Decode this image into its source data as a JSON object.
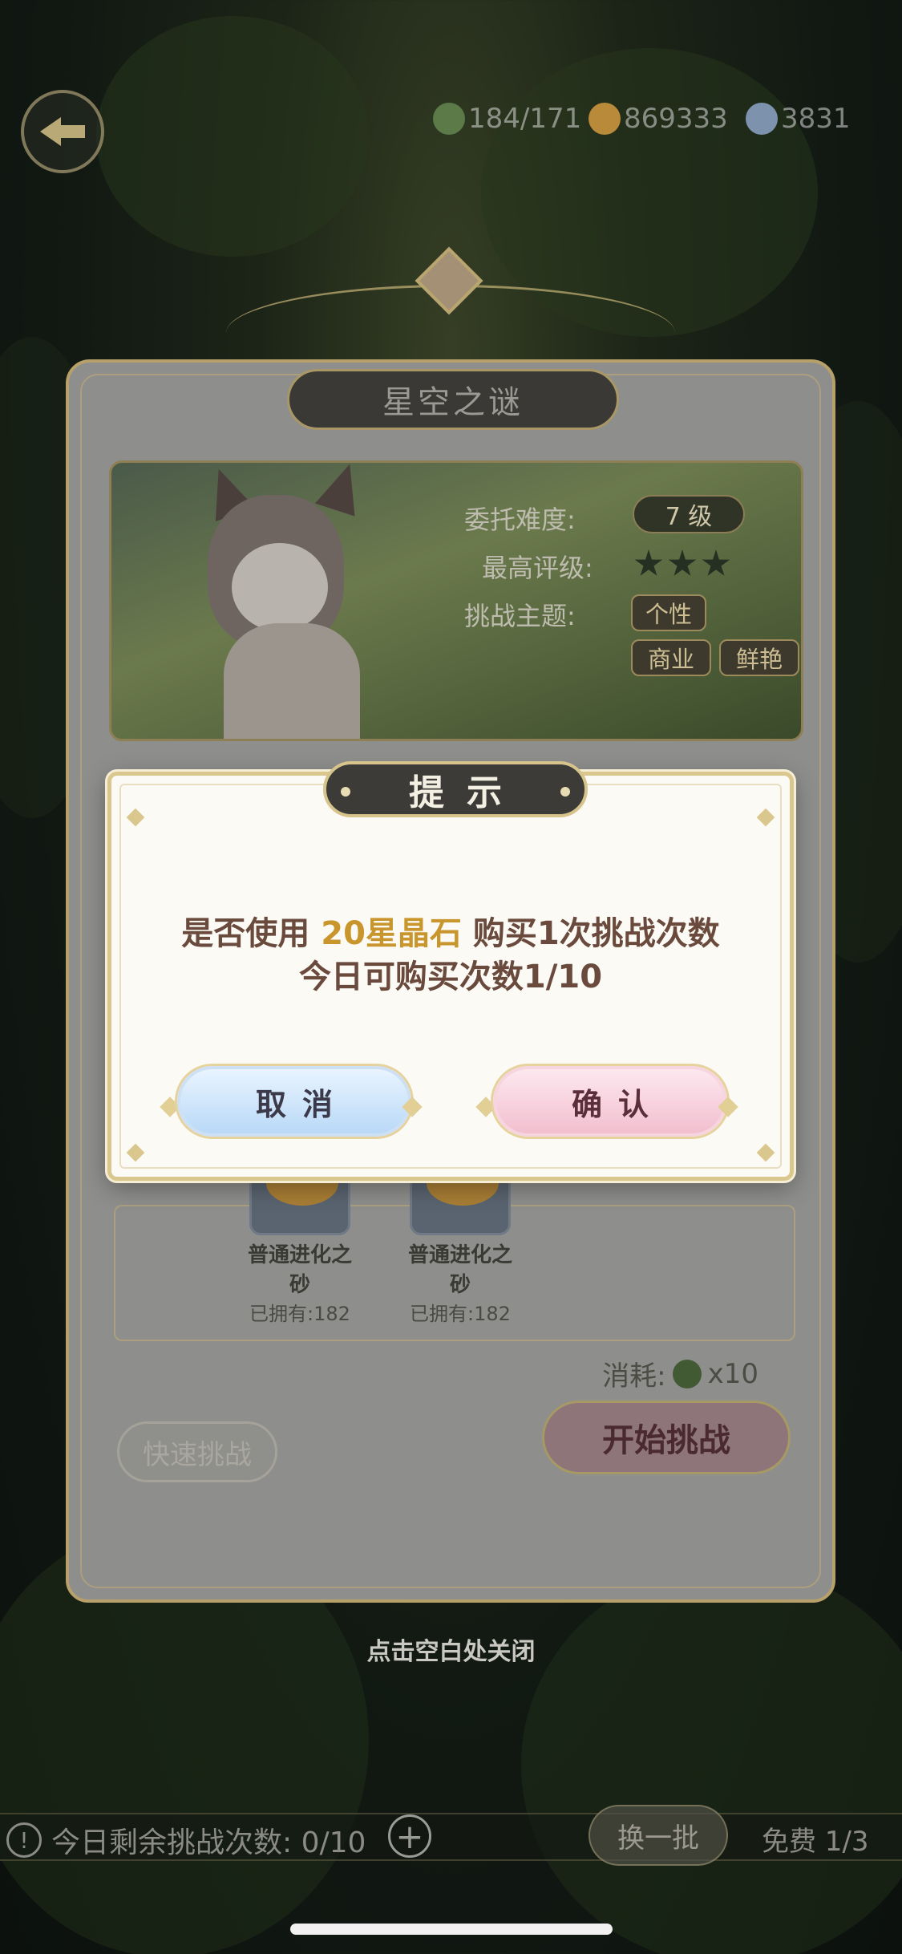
{
  "resources": {
    "stamina": "184/171",
    "gold": "869333",
    "crystal": "3831"
  },
  "panel": {
    "title": "星空之谜",
    "difficulty_label": "委托难度:",
    "difficulty_value": "7 级",
    "best_rating_label": "最高评级:",
    "best_rating_stars": 3,
    "theme_label": "挑战主题:",
    "themes": [
      "个性",
      "商业",
      "鲜艳"
    ]
  },
  "rewards": [
    {
      "name": "普通进化之砂",
      "owned": "已拥有:182"
    },
    {
      "name": "普通进化之砂",
      "owned": "已拥有:182"
    }
  ],
  "cost": {
    "label": "消耗:",
    "amount": "x10",
    "icon": "clover-icon"
  },
  "buttons": {
    "quick_challenge": "快速挑战",
    "start_challenge": "开始挑战"
  },
  "close_hint": "点击空白处关闭",
  "bottom": {
    "remaining_label": "今日剩余挑战次数: 0/10",
    "plus": "+",
    "refresh": "换一批",
    "free": "免费 1/3"
  },
  "dialog": {
    "title": "提示",
    "line1_prefix": "是否使用",
    "line1_highlight": "20星晶石",
    "line1_suffix": "购买1次挑战次数",
    "line2": "今日可购买次数1/10",
    "cancel": "取消",
    "confirm": "确认"
  },
  "colors": {
    "highlight": "#c8962c",
    "dialog_border": "#d9c78e",
    "cancel_btn": "#b9d9f7",
    "confirm_btn": "#f2bfcf"
  }
}
